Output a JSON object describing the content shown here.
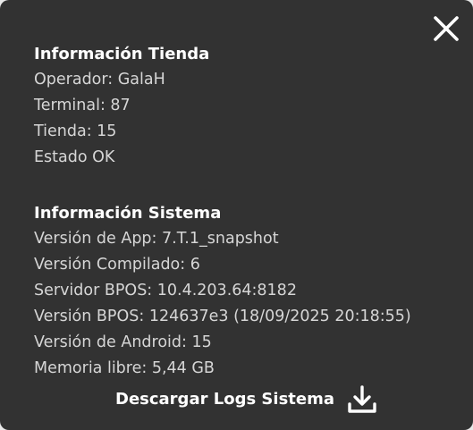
{
  "store_info": {
    "title": "Información Tienda",
    "operator": "Operador: GalaH",
    "terminal": "Terminal: 87",
    "store": "Tienda: 15",
    "status": "Estado OK"
  },
  "system_info": {
    "title": "Información Sistema",
    "app_version": "Versión de App: 7.T.1_snapshot",
    "build_version": "Versión Compilado: 6",
    "bpos_server": "Servidor BPOS: 10.4.203.64:8182",
    "bpos_version": "Versión BPOS: 124637e3 (18/09/2025 20:18:55)",
    "android_version": "Versión de Android: 15",
    "free_memory": "Memoria libre: 5,44 GB"
  },
  "actions": {
    "download_logs_label": "Descargar Logs Sistema",
    "download_icon": "download-icon",
    "close_icon": "close-icon"
  },
  "colors": {
    "panel_background": "#323232",
    "title_text": "#ffffff",
    "body_text": "#d6d6d6"
  }
}
